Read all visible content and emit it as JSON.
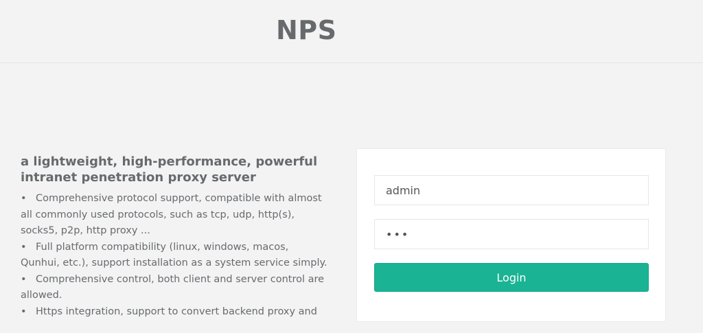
{
  "header": {
    "brand": "NPS"
  },
  "intro": {
    "heading": "a lightweight, high-performance, powerful intranet penetration proxy server",
    "features": [
      "Comprehensive protocol support, compatible with almost all commonly used protocols, such as tcp, udp, http(s), socks5, p2p, http proxy ...",
      "Full platform compatibility (linux, windows, macos, Qunhui, etc.), support installation as a system service simply.",
      "Comprehensive control, both client and server control are allowed.",
      "Https integration, support to convert backend proxy and"
    ]
  },
  "login": {
    "username_value": "admin",
    "password_value": "•••",
    "button_label": "Login"
  },
  "colors": {
    "accent": "#1ab394",
    "background": "#f3f3f4",
    "text": "#676a6c"
  }
}
